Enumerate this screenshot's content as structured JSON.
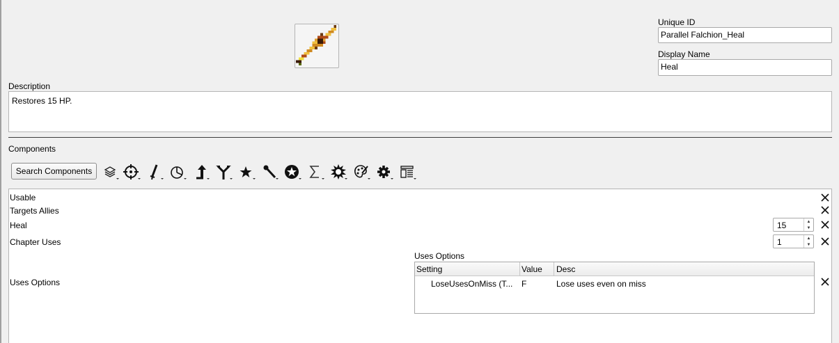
{
  "item_icon": {
    "name": "falchion-sprite-icon"
  },
  "unique_id": {
    "label": "Unique ID",
    "value": "Parallel Falchion_Heal"
  },
  "display_name": {
    "label": "Display Name",
    "value": "Heal"
  },
  "description": {
    "label": "Description",
    "value": "Restores 15 HP."
  },
  "components": {
    "label": "Components",
    "search_label": "Search Components",
    "toolbar_icons": [
      "layers-icon",
      "crosshair-icon",
      "sword-icon",
      "pie-icon",
      "arrow-up-icon",
      "branch-icon",
      "star-icon",
      "staff-icon",
      "star-circle-icon",
      "sigma-icon",
      "burst-icon",
      "palette-icon",
      "gear-icon",
      "layout-icon"
    ],
    "items": [
      {
        "name": "Usable"
      },
      {
        "name": "Targets Allies"
      },
      {
        "name": "Heal",
        "value": "15"
      },
      {
        "name": "Chapter Uses",
        "value": "1"
      },
      {
        "name": "Uses Options"
      }
    ],
    "uses_options": {
      "title": "Uses Options",
      "columns": [
        "Setting",
        "Value",
        "Desc"
      ],
      "rows": [
        {
          "setting": "LoseUsesOnMiss (T...",
          "value": "F",
          "desc": "Lose uses even on miss"
        }
      ]
    }
  }
}
